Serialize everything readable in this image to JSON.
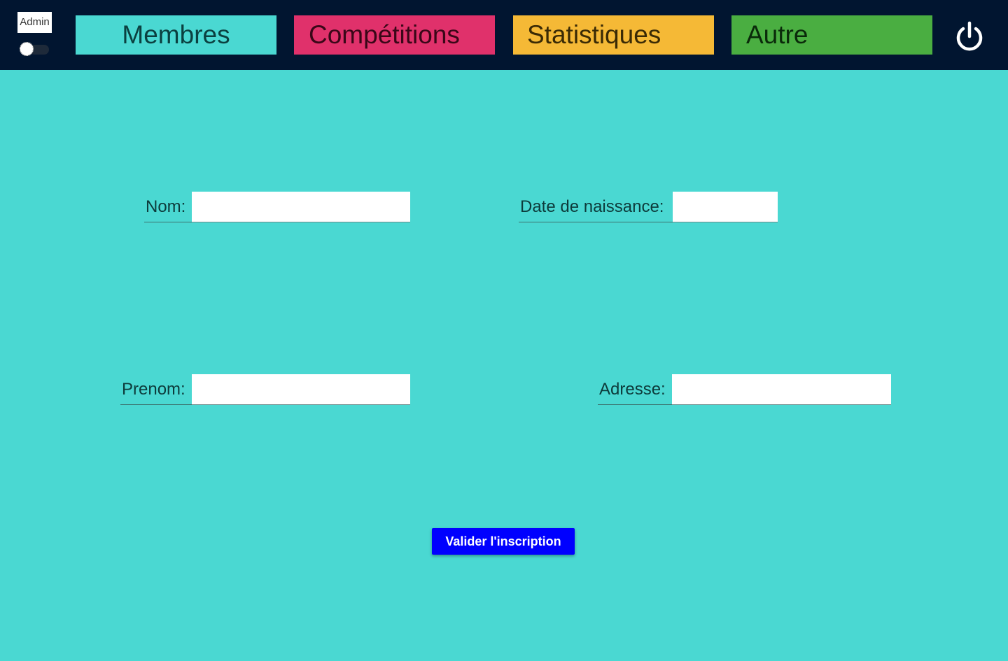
{
  "header": {
    "admin_label": "Admin",
    "nav": [
      {
        "label": "Membres",
        "bg": "#4ad8d2",
        "fg": "#0b4040"
      },
      {
        "label": "Compétitions",
        "bg": "#e0316b",
        "fg": "#3a0718"
      },
      {
        "label": "Statistiques",
        "bg": "#f5b936",
        "fg": "#3a2a05"
      },
      {
        "label": "Autre",
        "bg": "#4aae41",
        "fg": "#0a2a0a"
      }
    ],
    "power_icon": "power-icon"
  },
  "form": {
    "nom_label": "Nom:",
    "nom_value": "",
    "date_label": "Date de naissance:",
    "date_value": "",
    "prenom_label": "Prenom:",
    "prenom_value": "",
    "adresse_label": "Adresse:",
    "adresse_value": "",
    "submit_label": "Valider l'inscription"
  },
  "colors": {
    "page_bg": "#4ad8d2",
    "topbar_bg": "#011530",
    "button_bg": "#0000ff"
  }
}
